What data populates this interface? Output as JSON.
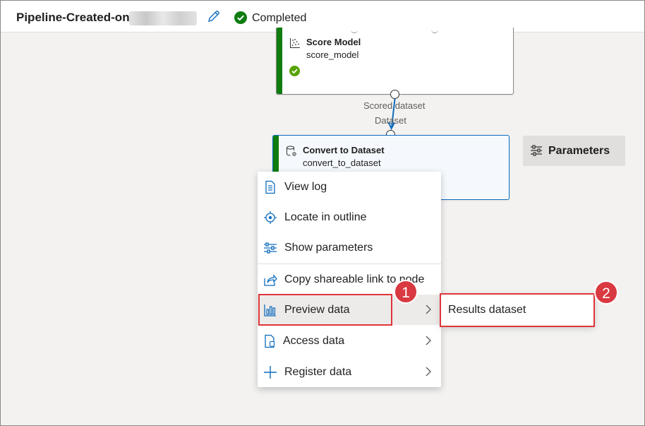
{
  "header": {
    "pipeline_title": "Pipeline-Created-on-",
    "status": "Completed",
    "status_color": "#107c10"
  },
  "nodes": {
    "score_model": {
      "title": "Score Model",
      "subtitle": "score_model",
      "status": "check-icon"
    },
    "convert_to_dataset": {
      "title": "Convert to Dataset",
      "subtitle": "convert_to_dataset"
    }
  },
  "ports": {
    "output_label": "Scored dataset",
    "input_label": "Dataset"
  },
  "parameters_button": {
    "label": "Parameters",
    "icon": "sliders-icon"
  },
  "context_menu": {
    "items": [
      {
        "label": "View log",
        "icon": "document-icon",
        "has_submenu": false
      },
      {
        "label": "Locate in outline",
        "icon": "locate-icon",
        "has_submenu": false
      },
      {
        "label": "Show parameters",
        "icon": "sliders-icon",
        "has_submenu": false
      },
      {
        "label": "Copy shareable link to node",
        "icon": "share-icon",
        "has_submenu": false
      },
      {
        "label": "Preview data",
        "icon": "bar-chart-icon",
        "has_submenu": true
      },
      {
        "label": "Access data",
        "icon": "file-data-icon",
        "has_submenu": true
      },
      {
        "label": "Register data",
        "icon": "plus-icon",
        "has_submenu": true
      }
    ]
  },
  "submenu": {
    "label": "Results dataset"
  },
  "annotations": {
    "badge_1": "1",
    "badge_2": "2",
    "highlight_color": "#e0353b"
  }
}
